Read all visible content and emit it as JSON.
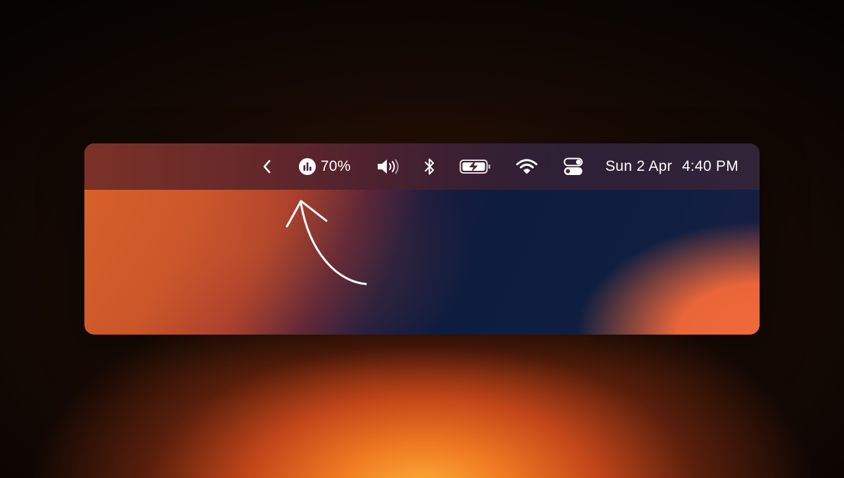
{
  "menubar": {
    "collapse_icon": "chevron-left-icon",
    "stats": {
      "icon": "bar-chart-circle-icon",
      "label": "70%"
    },
    "volume_icon": "speaker-volume-icon",
    "bluetooth_icon": "bluetooth-icon",
    "battery_icon": "battery-charging-icon",
    "wifi_icon": "wifi-icon",
    "control_center_icon": "control-center-toggle-icon",
    "date": "Sun 2 Apr",
    "time": "4:40 PM"
  },
  "annotation": {
    "arrow_icon": "hand-drawn-arrow-icon"
  },
  "colors": {
    "menubar_text": "#ffffff",
    "glow": "#f07a22",
    "wallpaper_navy": "#0d1d3e"
  }
}
